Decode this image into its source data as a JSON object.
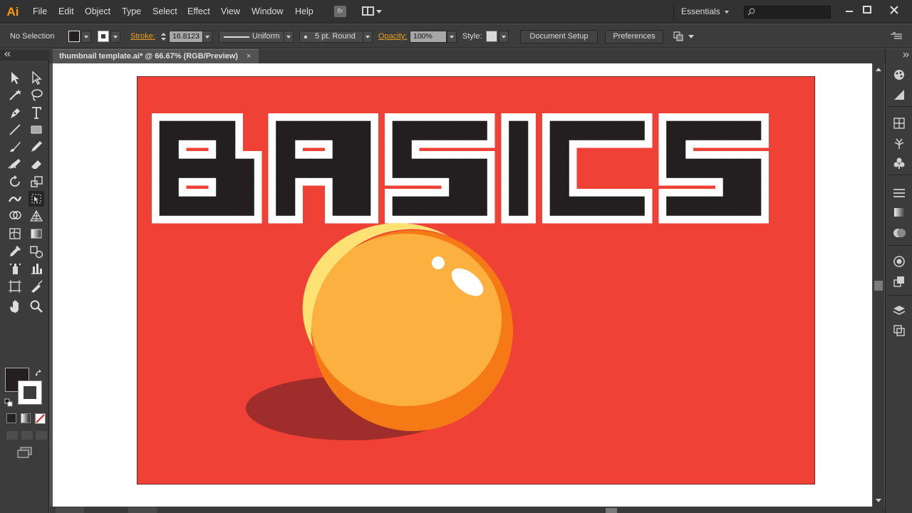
{
  "app": {
    "logo": "Ai"
  },
  "menu": [
    "File",
    "Edit",
    "Object",
    "Type",
    "Select",
    "Effect",
    "View",
    "Window",
    "Help"
  ],
  "bridge_label": "Br",
  "workspace": {
    "label": "Essentials"
  },
  "control": {
    "selection": "No Selection",
    "stroke_label": "Stroke:",
    "stroke_weight": "16.8123",
    "profile": "Uniform",
    "brush": "5 pt. Round",
    "opacity_label": "Opacity:",
    "opacity": "100%",
    "style_label": "Style:",
    "document_setup": "Document Setup",
    "preferences": "Preferences"
  },
  "document": {
    "tab_title": "thumbnail template.ai* @ 66.67% (RGB/Preview)",
    "close": "×"
  },
  "artwork": {
    "headline": "BASICS",
    "colors": {
      "background": "#ef4136",
      "letters": "#231f20",
      "outline": "#ffffff",
      "sphere_light": "#fcb040",
      "sphere_top": "#ffe174",
      "sphere_dark": "#f57a15",
      "shadow": "#9e2d2c"
    }
  },
  "toolbar_tools": [
    "selection-tool",
    "direct-selection-tool",
    "magic-wand-tool",
    "lasso-tool",
    "pen-tool",
    "type-tool",
    "line-tool",
    "rectangle-tool",
    "paintbrush-tool",
    "pencil-tool",
    "blob-brush-tool",
    "eraser-tool",
    "rotate-tool",
    "scale-tool",
    "width-tool",
    "free-transform-tool",
    "shape-builder-tool",
    "perspective-grid-tool",
    "mesh-tool",
    "gradient-tool",
    "eyedropper-tool",
    "blend-tool",
    "symbol-sprayer-tool",
    "column-graph-tool",
    "artboard-tool",
    "slice-tool",
    "hand-tool",
    "zoom-tool"
  ],
  "dock_panels": [
    "color-panel",
    "color-guide-panel",
    "swatches-panel",
    "brushes-panel",
    "symbols-panel",
    "stroke-panel",
    "gradient-panel",
    "transparency-panel",
    "appearance-panel",
    "graphic-styles-panel",
    "layers-panel",
    "artboards-panel"
  ]
}
